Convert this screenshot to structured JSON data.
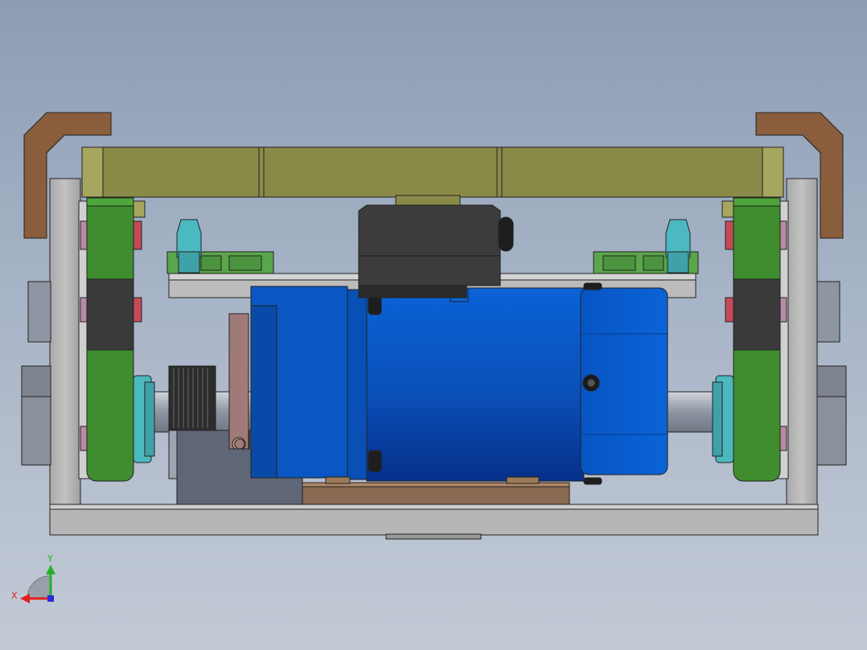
{
  "viewport": {
    "background_top": "#8c9cb3",
    "background_bottom": "#c3cad6"
  },
  "triad": {
    "x_label": "X",
    "y_label": "Y",
    "x_color": "#e0201c",
    "y_color": "#22b02a",
    "z_color": "#2a2ad8"
  },
  "model": {
    "motor_color": "#0a5fd0",
    "wheel_color": "#3f8d2e",
    "top_beam_color": "#8a8a48",
    "frame_color": "#b4b4b4",
    "handle_color": "#8a5d3c",
    "icons": [
      "robot-assembly-icon",
      "motor-icon",
      "wheel-icon",
      "gear-icon",
      "handle-icon"
    ]
  }
}
